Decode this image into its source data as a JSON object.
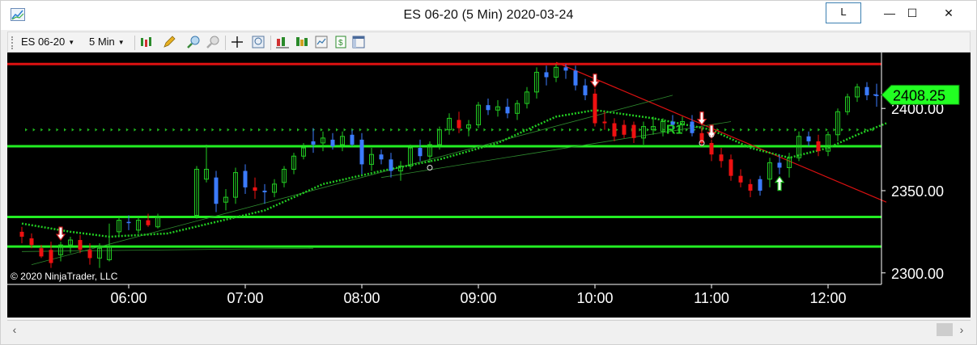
{
  "window": {
    "title": "ES 06-20 (5 Min)  2020-03-24",
    "link_button": "L",
    "minimize": "—",
    "maximize": "☐",
    "close": "✕"
  },
  "toolbar": {
    "instrument": "ES 06-20",
    "interval": "5 Min",
    "icons": [
      "bars-type-icon",
      "drawing-pencil-icon",
      "zoom-in-icon",
      "zoom-out-icon",
      "crosshair-icon",
      "data-box-icon",
      "indicators-icon",
      "strategies-icon",
      "chart-templates-icon",
      "order-ticket-icon",
      "properties-icon"
    ]
  },
  "chart": {
    "copyright": "© 2020 NinjaTrader, LLC",
    "current_price": "2408.25",
    "r1_label": "R1",
    "colors": {
      "background": "#000000",
      "up_bar": "#22cc22",
      "down_bar": "#ee1111",
      "neutral_bar": "#3b7bff",
      "support_line": "#22ee22",
      "resistance_line": "#dd1111",
      "trend_line": "#dd1111",
      "ma_line": "#22cc22",
      "price_tag_bg": "#22ff22"
    }
  },
  "chart_data": {
    "type": "candlestick",
    "title": "ES 06-20 (5 Min)  2020-03-24",
    "x_ticks": [
      "06:00",
      "07:00",
      "08:00",
      "09:00",
      "10:00",
      "11:00",
      "12:00"
    ],
    "y_ticks": [
      "2300.00",
      "2350.00",
      "2400.00"
    ],
    "ylim": [
      2293,
      2434
    ],
    "last_price": 2408.25,
    "horizontal_lines": [
      {
        "price": 2427,
        "color": "#dd1111"
      },
      {
        "price": 2377,
        "color": "#22ee22"
      },
      {
        "price": 2334,
        "color": "#22ee22"
      },
      {
        "price": 2316,
        "color": "#22ee22"
      }
    ],
    "dotted_level": 2387,
    "candles": [
      {
        "t": "05:05",
        "o": 2325,
        "h": 2328,
        "l": 2318,
        "c": 2322,
        "dir": "down"
      },
      {
        "t": "05:10",
        "o": 2321,
        "h": 2324,
        "l": 2315,
        "c": 2317,
        "dir": "down"
      },
      {
        "t": "05:15",
        "o": 2315,
        "h": 2317,
        "l": 2309,
        "c": 2310,
        "dir": "down"
      },
      {
        "t": "05:20",
        "o": 2314,
        "h": 2319,
        "l": 2303,
        "c": 2306,
        "dir": "down"
      },
      {
        "t": "05:25",
        "o": 2311,
        "h": 2319,
        "l": 2307,
        "c": 2317,
        "dir": "up"
      },
      {
        "t": "05:30",
        "o": 2317,
        "h": 2322,
        "l": 2312,
        "c": 2320,
        "dir": "up"
      },
      {
        "t": "05:35",
        "o": 2320,
        "h": 2323,
        "l": 2312,
        "c": 2314,
        "dir": "down"
      },
      {
        "t": "05:40",
        "o": 2314,
        "h": 2318,
        "l": 2305,
        "c": 2309,
        "dir": "down"
      },
      {
        "t": "05:45",
        "o": 2309,
        "h": 2318,
        "l": 2303,
        "c": 2315,
        "dir": "up"
      },
      {
        "t": "05:50",
        "o": 2316,
        "h": 2330,
        "l": 2307,
        "c": 2308,
        "dir": "up"
      },
      {
        "t": "05:55",
        "o": 2325,
        "h": 2334,
        "l": 2322,
        "c": 2332,
        "dir": "up"
      },
      {
        "t": "06:00",
        "o": 2331,
        "h": 2335,
        "l": 2326,
        "c": 2331,
        "dir": "neutral"
      },
      {
        "t": "06:05",
        "o": 2326,
        "h": 2334,
        "l": 2324,
        "c": 2332,
        "dir": "up"
      },
      {
        "t": "06:10",
        "o": 2332,
        "h": 2336,
        "l": 2328,
        "c": 2329,
        "dir": "down"
      },
      {
        "t": "06:15",
        "o": 2328,
        "h": 2336,
        "l": 2327,
        "c": 2334,
        "dir": "up"
      },
      {
        "t": "06:35",
        "o": 2335,
        "h": 2365,
        "l": 2333,
        "c": 2363,
        "dir": "up"
      },
      {
        "t": "06:40",
        "o": 2363,
        "h": 2378,
        "l": 2355,
        "c": 2357,
        "dir": "up"
      },
      {
        "t": "06:45",
        "o": 2358,
        "h": 2362,
        "l": 2337,
        "c": 2342,
        "dir": "neutral"
      },
      {
        "t": "06:50",
        "o": 2343,
        "h": 2351,
        "l": 2338,
        "c": 2346,
        "dir": "up"
      },
      {
        "t": "06:55",
        "o": 2346,
        "h": 2364,
        "l": 2342,
        "c": 2361,
        "dir": "up"
      },
      {
        "t": "07:00",
        "o": 2362,
        "h": 2366,
        "l": 2348,
        "c": 2352,
        "dir": "neutral"
      },
      {
        "t": "07:05",
        "o": 2352,
        "h": 2358,
        "l": 2345,
        "c": 2350,
        "dir": "down"
      },
      {
        "t": "07:10",
        "o": 2350,
        "h": 2354,
        "l": 2342,
        "c": 2349,
        "dir": "neutral"
      },
      {
        "t": "07:15",
        "o": 2349,
        "h": 2357,
        "l": 2346,
        "c": 2354,
        "dir": "up"
      },
      {
        "t": "07:20",
        "o": 2355,
        "h": 2365,
        "l": 2352,
        "c": 2363,
        "dir": "up"
      },
      {
        "t": "07:25",
        "o": 2363,
        "h": 2373,
        "l": 2360,
        "c": 2371,
        "dir": "up"
      },
      {
        "t": "07:30",
        "o": 2371,
        "h": 2379,
        "l": 2369,
        "c": 2376,
        "dir": "up"
      },
      {
        "t": "07:35",
        "o": 2378,
        "h": 2388,
        "l": 2373,
        "c": 2380,
        "dir": "neutral"
      },
      {
        "t": "07:40",
        "o": 2379,
        "h": 2386,
        "l": 2374,
        "c": 2382,
        "dir": "up"
      },
      {
        "t": "07:45",
        "o": 2381,
        "h": 2385,
        "l": 2375,
        "c": 2377,
        "dir": "neutral"
      },
      {
        "t": "07:50",
        "o": 2378,
        "h": 2386,
        "l": 2374,
        "c": 2383,
        "dir": "up"
      },
      {
        "t": "07:55",
        "o": 2384,
        "h": 2387,
        "l": 2377,
        "c": 2378,
        "dir": "neutral"
      },
      {
        "t": "08:00",
        "o": 2381,
        "h": 2385,
        "l": 2360,
        "c": 2366,
        "dir": "neutral"
      },
      {
        "t": "08:05",
        "o": 2366,
        "h": 2376,
        "l": 2362,
        "c": 2372,
        "dir": "up"
      },
      {
        "t": "08:10",
        "o": 2372,
        "h": 2375,
        "l": 2366,
        "c": 2369,
        "dir": "neutral"
      },
      {
        "t": "08:15",
        "o": 2369,
        "h": 2373,
        "l": 2358,
        "c": 2362,
        "dir": "neutral"
      },
      {
        "t": "08:20",
        "o": 2362,
        "h": 2368,
        "l": 2356,
        "c": 2365,
        "dir": "up"
      },
      {
        "t": "08:25",
        "o": 2365,
        "h": 2378,
        "l": 2363,
        "c": 2376,
        "dir": "up"
      },
      {
        "t": "08:30",
        "o": 2376,
        "h": 2381,
        "l": 2368,
        "c": 2371,
        "dir": "neutral"
      },
      {
        "t": "08:35",
        "o": 2371,
        "h": 2380,
        "l": 2367,
        "c": 2378,
        "dir": "up"
      },
      {
        "t": "08:40",
        "o": 2378,
        "h": 2389,
        "l": 2375,
        "c": 2387,
        "dir": "up"
      },
      {
        "t": "08:45",
        "o": 2387,
        "h": 2397,
        "l": 2384,
        "c": 2394,
        "dir": "up"
      },
      {
        "t": "08:50",
        "o": 2393,
        "h": 2398,
        "l": 2385,
        "c": 2388,
        "dir": "down"
      },
      {
        "t": "08:55",
        "o": 2388,
        "h": 2393,
        "l": 2383,
        "c": 2390,
        "dir": "up"
      },
      {
        "t": "09:00",
        "o": 2390,
        "h": 2404,
        "l": 2388,
        "c": 2402,
        "dir": "up"
      },
      {
        "t": "09:05",
        "o": 2402,
        "h": 2406,
        "l": 2396,
        "c": 2399,
        "dir": "neutral"
      },
      {
        "t": "09:10",
        "o": 2399,
        "h": 2405,
        "l": 2395,
        "c": 2401,
        "dir": "up"
      },
      {
        "t": "09:15",
        "o": 2401,
        "h": 2406,
        "l": 2394,
        "c": 2397,
        "dir": "neutral"
      },
      {
        "t": "09:20",
        "o": 2397,
        "h": 2405,
        "l": 2393,
        "c": 2403,
        "dir": "up"
      },
      {
        "t": "09:25",
        "o": 2403,
        "h": 2413,
        "l": 2400,
        "c": 2410,
        "dir": "up"
      },
      {
        "t": "09:30",
        "o": 2410,
        "h": 2425,
        "l": 2406,
        "c": 2422,
        "dir": "up"
      },
      {
        "t": "09:35",
        "o": 2422,
        "h": 2426,
        "l": 2414,
        "c": 2419,
        "dir": "neutral"
      },
      {
        "t": "09:40",
        "o": 2419,
        "h": 2427,
        "l": 2416,
        "c": 2425,
        "dir": "up"
      },
      {
        "t": "09:45",
        "o": 2425,
        "h": 2427,
        "l": 2418,
        "c": 2423,
        "dir": "neutral"
      },
      {
        "t": "09:50",
        "o": 2423,
        "h": 2426,
        "l": 2411,
        "c": 2414,
        "dir": "neutral"
      },
      {
        "t": "09:55",
        "o": 2414,
        "h": 2418,
        "l": 2405,
        "c": 2408,
        "dir": "neutral"
      },
      {
        "t": "10:00",
        "o": 2409,
        "h": 2412,
        "l": 2389,
        "c": 2391,
        "dir": "down"
      },
      {
        "t": "10:05",
        "o": 2391,
        "h": 2398,
        "l": 2387,
        "c": 2392,
        "dir": "down"
      },
      {
        "t": "10:10",
        "o": 2391,
        "h": 2394,
        "l": 2380,
        "c": 2383,
        "dir": "down"
      },
      {
        "t": "10:15",
        "o": 2384,
        "h": 2393,
        "l": 2382,
        "c": 2390,
        "dir": "down"
      },
      {
        "t": "10:20",
        "o": 2390,
        "h": 2392,
        "l": 2379,
        "c": 2382,
        "dir": "down"
      },
      {
        "t": "10:25",
        "o": 2382,
        "h": 2392,
        "l": 2378,
        "c": 2389,
        "dir": "up"
      },
      {
        "t": "10:30",
        "o": 2389,
        "h": 2395,
        "l": 2384,
        "c": 2387,
        "dir": "up"
      },
      {
        "t": "10:35",
        "o": 2386,
        "h": 2394,
        "l": 2383,
        "c": 2392,
        "dir": "up"
      },
      {
        "t": "10:40",
        "o": 2392,
        "h": 2396,
        "l": 2386,
        "c": 2390,
        "dir": "neutral"
      },
      {
        "t": "10:45",
        "o": 2390,
        "h": 2395,
        "l": 2386,
        "c": 2392,
        "dir": "up"
      },
      {
        "t": "10:50",
        "o": 2392,
        "h": 2396,
        "l": 2383,
        "c": 2385,
        "dir": "neutral"
      },
      {
        "t": "10:55",
        "o": 2385,
        "h": 2389,
        "l": 2377,
        "c": 2379,
        "dir": "down"
      },
      {
        "t": "11:00",
        "o": 2379,
        "h": 2381,
        "l": 2368,
        "c": 2372,
        "dir": "down"
      },
      {
        "t": "11:05",
        "o": 2372,
        "h": 2376,
        "l": 2364,
        "c": 2368,
        "dir": "down"
      },
      {
        "t": "11:10",
        "o": 2369,
        "h": 2372,
        "l": 2356,
        "c": 2359,
        "dir": "down"
      },
      {
        "t": "11:15",
        "o": 2359,
        "h": 2363,
        "l": 2352,
        "c": 2355,
        "dir": "down"
      },
      {
        "t": "11:20",
        "o": 2354,
        "h": 2357,
        "l": 2346,
        "c": 2350,
        "dir": "down"
      },
      {
        "t": "11:25",
        "o": 2350,
        "h": 2359,
        "l": 2347,
        "c": 2357,
        "dir": "neutral"
      },
      {
        "t": "11:30",
        "o": 2357,
        "h": 2370,
        "l": 2352,
        "c": 2367,
        "dir": "up"
      },
      {
        "t": "11:35",
        "o": 2367,
        "h": 2372,
        "l": 2360,
        "c": 2364,
        "dir": "neutral"
      },
      {
        "t": "11:40",
        "o": 2364,
        "h": 2373,
        "l": 2358,
        "c": 2370,
        "dir": "up"
      },
      {
        "t": "11:45",
        "o": 2370,
        "h": 2386,
        "l": 2368,
        "c": 2383,
        "dir": "up"
      },
      {
        "t": "11:50",
        "o": 2383,
        "h": 2386,
        "l": 2377,
        "c": 2380,
        "dir": "neutral"
      },
      {
        "t": "11:55",
        "o": 2380,
        "h": 2384,
        "l": 2371,
        "c": 2374,
        "dir": "down"
      },
      {
        "t": "12:00",
        "o": 2374,
        "h": 2386,
        "l": 2371,
        "c": 2384,
        "dir": "up"
      },
      {
        "t": "12:05",
        "o": 2384,
        "h": 2400,
        "l": 2380,
        "c": 2398,
        "dir": "up"
      },
      {
        "t": "12:10",
        "o": 2398,
        "h": 2409,
        "l": 2396,
        "c": 2407,
        "dir": "up"
      },
      {
        "t": "12:15",
        "o": 2407,
        "h": 2415,
        "l": 2404,
        "c": 2413,
        "dir": "up"
      },
      {
        "t": "12:20",
        "o": 2413,
        "h": 2416,
        "l": 2405,
        "c": 2408,
        "dir": "neutral"
      },
      {
        "t": "12:25",
        "o": 2408,
        "h": 2415,
        "l": 2401,
        "c": 2408.25,
        "dir": "neutral"
      }
    ],
    "ma": [
      {
        "t": "05:05",
        "v": 2330
      },
      {
        "t": "05:30",
        "v": 2325
      },
      {
        "t": "05:50",
        "v": 2322
      },
      {
        "t": "06:20",
        "v": 2324
      },
      {
        "t": "06:45",
        "v": 2331
      },
      {
        "t": "07:10",
        "v": 2338
      },
      {
        "t": "07:40",
        "v": 2354
      },
      {
        "t": "08:10",
        "v": 2362
      },
      {
        "t": "08:40",
        "v": 2369
      },
      {
        "t": "09:10",
        "v": 2379
      },
      {
        "t": "09:40",
        "v": 2395
      },
      {
        "t": "10:00",
        "v": 2399
      },
      {
        "t": "10:30",
        "v": 2394
      },
      {
        "t": "11:00",
        "v": 2387
      },
      {
        "t": "11:20",
        "v": 2376
      },
      {
        "t": "11:40",
        "v": 2370
      },
      {
        "t": "12:00",
        "v": 2376
      },
      {
        "t": "12:15",
        "v": 2384
      },
      {
        "t": "12:30",
        "v": 2391
      }
    ],
    "trend_lines": [
      {
        "from": {
          "t": "09:40",
          "p": 2428
        },
        "to": {
          "t": "12:30",
          "p": 2343
        },
        "color": "#dd1111",
        "width": 1.2
      },
      {
        "from": {
          "t": "05:05",
          "p": 2313
        },
        "to": {
          "t": "07:35",
          "p": 2315
        },
        "color": "#2e8b2e",
        "width": 0.8
      },
      {
        "from": {
          "t": "05:10",
          "p": 2305
        },
        "to": {
          "t": "10:40",
          "p": 2408
        },
        "color": "#2e8b2e",
        "width": 0.8
      },
      {
        "from": {
          "t": "08:10",
          "p": 2358
        },
        "to": {
          "t": "11:10",
          "p": 2392
        },
        "color": "#2e8b2e",
        "width": 0.8
      }
    ],
    "signals": [
      {
        "t": "10:00",
        "type": "sell"
      },
      {
        "t": "10:55",
        "type": "sell"
      },
      {
        "t": "11:00",
        "type": "sell"
      },
      {
        "t": "11:35",
        "type": "buy"
      },
      {
        "t": "05:25",
        "type": "sell"
      }
    ]
  }
}
